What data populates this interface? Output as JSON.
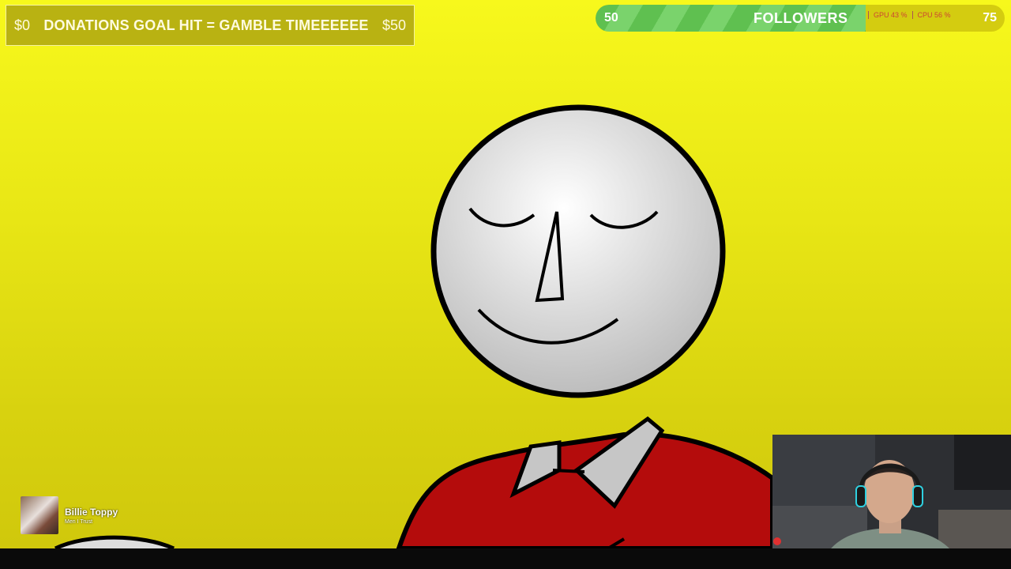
{
  "donation_goal": {
    "start": "$0",
    "title": "DONATIONS GOAL HIT = GAMBLE TIMEEEEEE",
    "end": "$50"
  },
  "followers_goal": {
    "start": "50",
    "label": "FOLLOWERS",
    "end": "75",
    "progress_fraction": 0.66,
    "stats": [
      "GPU 43 %",
      "CPU 56 %"
    ]
  },
  "now_playing": {
    "title": "Billie Toppy",
    "artist": "Men I Trust"
  },
  "colors": {
    "background": "#f0ee18",
    "bar": "#b9b212",
    "follower_fill": "#66c456",
    "shirt": "#b80c0c"
  }
}
